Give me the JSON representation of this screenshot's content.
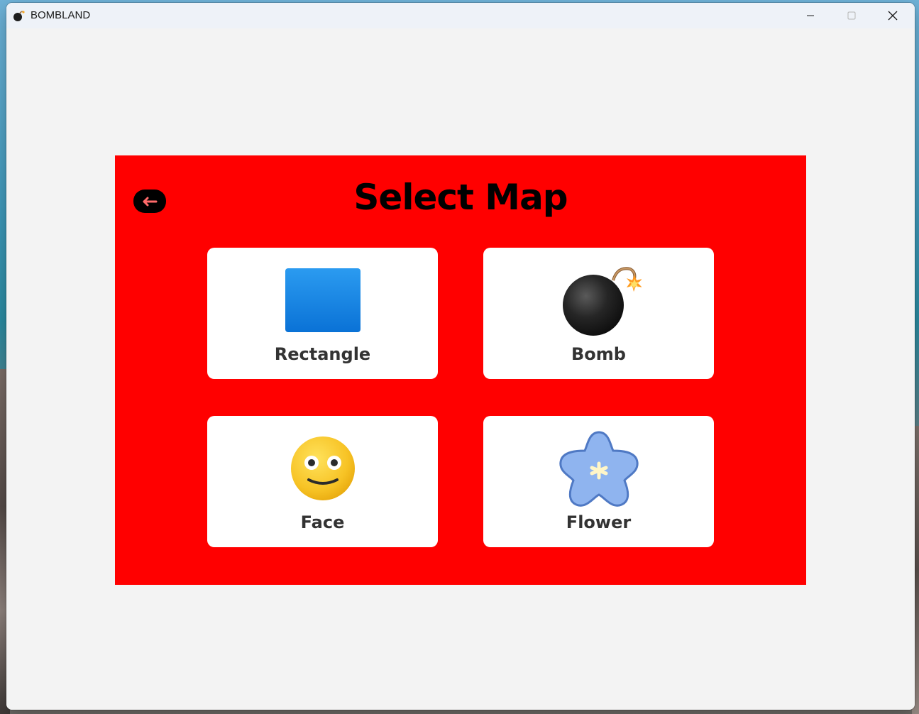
{
  "window": {
    "title": "BOMBLAND",
    "icon": "bomb-icon",
    "controls": [
      "minimize-icon",
      "maximize-icon",
      "close-icon"
    ]
  },
  "panel": {
    "background": "#ff0000",
    "title": "Select Map",
    "back_icon": "left-arrow-icon",
    "back_arrow_color": "#ff6b6b"
  },
  "maps": [
    {
      "label": "Rectangle",
      "icon": "blue-square-icon"
    },
    {
      "label": "Bomb",
      "icon": "bomb-icon"
    },
    {
      "label": "Face",
      "icon": "smiley-face-icon"
    },
    {
      "label": "Flower",
      "icon": "blue-flower-icon"
    }
  ]
}
